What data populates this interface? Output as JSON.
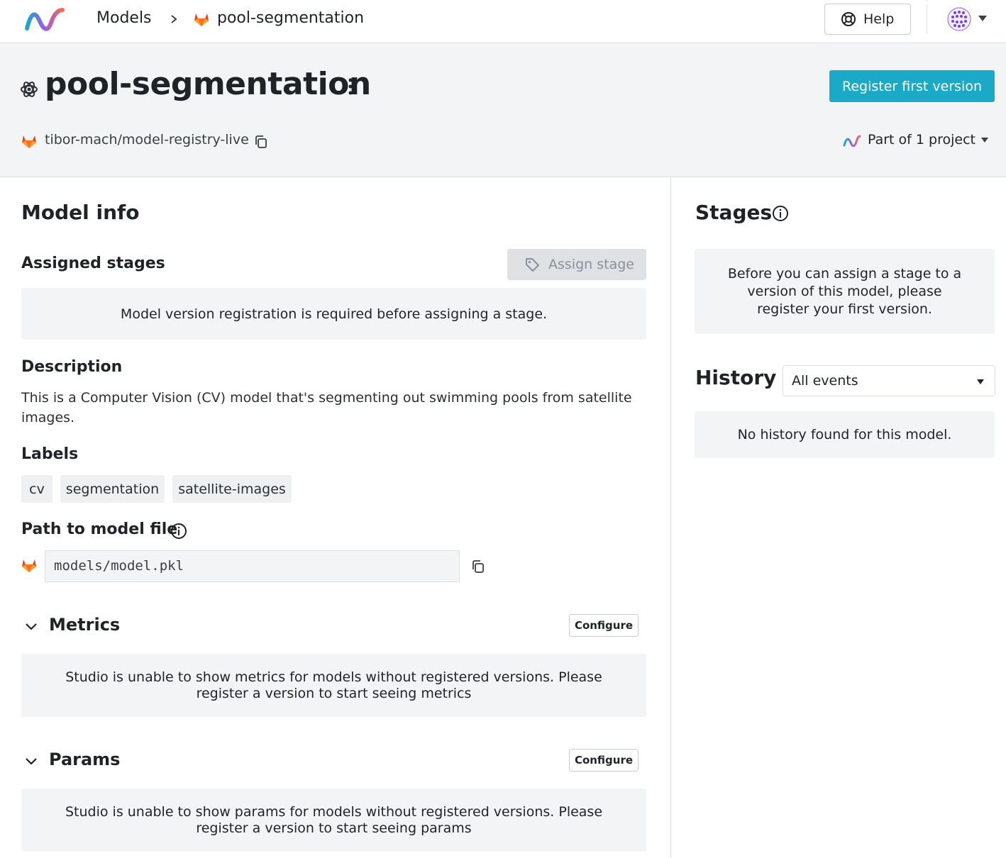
{
  "breadcrumb": {
    "models_label": "Models",
    "current_label": "pool-segmentation"
  },
  "topbar": {
    "help_label": "Help"
  },
  "header": {
    "title": "pool-segmentation",
    "register_label": "Register first version",
    "repo": "tibor-mach/model-registry-live",
    "project_label": "Part of 1 project"
  },
  "model_info": {
    "heading": "Model info",
    "assigned_stages": {
      "heading": "Assigned stages",
      "button_label": "Assign stage",
      "message": "Model version registration is required before assigning a stage."
    },
    "description": {
      "heading": "Description",
      "text": "This is a Computer Vision (CV) model that's segmenting out swimming pools from satellite images."
    },
    "labels": {
      "heading": "Labels",
      "items": [
        "cv",
        "segmentation",
        "satellite-images"
      ]
    },
    "path": {
      "heading": "Path to model file",
      "value": "models/model.pkl"
    },
    "metrics": {
      "heading": "Metrics",
      "configure_label": "Configure",
      "message": "Studio is unable to show metrics for models without registered versions. Please register a version to start seeing metrics"
    },
    "params": {
      "heading": "Params",
      "configure_label": "Configure",
      "message": "Studio is unable to show params for models without registered versions. Please register a version to start seeing params"
    }
  },
  "sidebar": {
    "stages": {
      "heading": "Stages",
      "message": "Before you can assign a stage to a version of this model, please register your first version."
    },
    "history": {
      "heading": "History",
      "filter_value": "All events",
      "message": "No history found for this model."
    }
  },
  "colors": {
    "primary_button": "#1aa9c6",
    "panel_bg": "#f3f4f6",
    "border": "#dcdfe3",
    "text": "#1f2328"
  }
}
